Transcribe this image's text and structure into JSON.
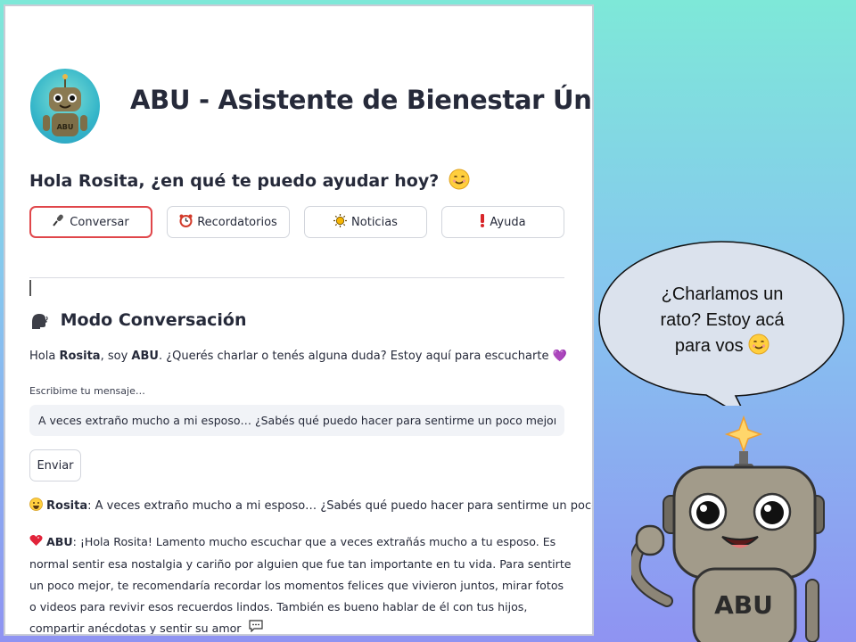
{
  "app": {
    "title": "ABU - Asistente de Bienestar Único",
    "avatar_badge": "ABU"
  },
  "greeting": "Hola Rosita, ¿en qué te puedo ayudar hoy?",
  "nav": [
    {
      "label": "Conversar",
      "icon": "microphone-icon",
      "active": true
    },
    {
      "label": "Recordatorios",
      "icon": "alarm-clock-icon",
      "active": false
    },
    {
      "label": "Noticias",
      "icon": "sun-icon",
      "active": false
    },
    {
      "label": "Ayuda",
      "icon": "exclamation-icon",
      "active": false
    }
  ],
  "conversation": {
    "title": "Modo Conversación",
    "intro_prefix": "Hola ",
    "intro_name": "Rosita",
    "intro_mid": ", soy ",
    "intro_bot": "ABU",
    "intro_rest": ". ¿Querés charlar o tenés alguna duda? Estoy aquí para escucharte",
    "input_label": "Escribime tu mensaje…",
    "input_value": "A veces extraño mucho a mi esposo… ¿Sabés qué puedo hacer para sentirme un poco mejor?",
    "send_label": "Enviar",
    "user_name": "Rosita",
    "user_message": ": A veces extraño mucho a mi esposo… ¿Sabés qué puedo hacer para sentirme un poco mejor?",
    "bot_name": "ABU",
    "bot_message": ": ¡Hola Rosita! Lamento mucho escuchar que a veces extrañás mucho a tu esposo. Es normal sentir esa nostalgia y cariño por alguien que fue tan importante en tu vida. Para sentirte un poco mejor, te recomendaría recordar los momentos felices que vivieron juntos, mirar fotos o videos para revivir esos recuerdos lindos. También es bueno hablar de él con tus hijos, compartir anécdotas y sentir su amor"
  },
  "mascot": {
    "bubble_line1": "¿Charlamos un",
    "bubble_line2": "rato? Estoy acá",
    "bubble_line3": "para vos",
    "badge": "ABU"
  },
  "colors": {
    "accent_red": "#e0464a",
    "text": "#262a3a",
    "input_bg": "#f1f3f7"
  }
}
